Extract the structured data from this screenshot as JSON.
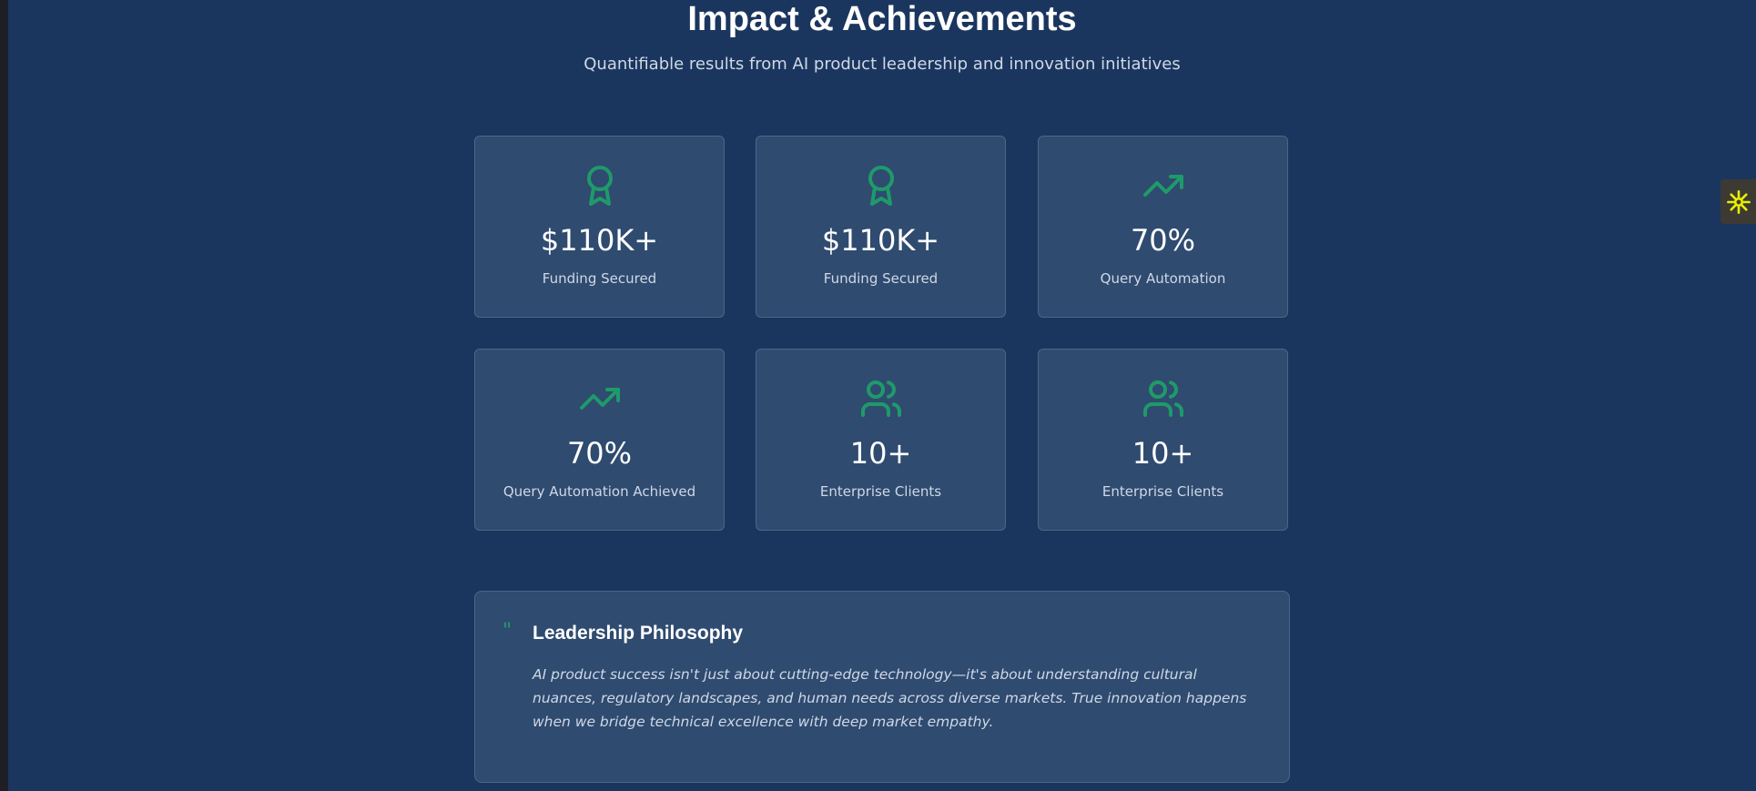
{
  "header": {
    "title": "Impact & Achievements",
    "subtitle": "Quantifiable results from AI product leadership and innovation initiatives"
  },
  "stats": [
    {
      "icon": "award-icon",
      "value": "$110K+",
      "label": "Funding Secured"
    },
    {
      "icon": "award-icon",
      "value": "$110K+",
      "label": "Funding Secured"
    },
    {
      "icon": "trending-up-icon",
      "value": "70%",
      "label": "Query Automation"
    },
    {
      "icon": "trending-up-icon",
      "value": "70%",
      "label": "Query Automation Achieved"
    },
    {
      "icon": "users-icon",
      "value": "10+",
      "label": "Enterprise Clients"
    },
    {
      "icon": "users-icon",
      "value": "10+",
      "label": "Enterprise Clients"
    }
  ],
  "philosophy": {
    "quote_mark": "\"",
    "title": "Leadership Philosophy",
    "text": "AI product success isn't just about cutting-edge technology—it's about understanding cultural nuances, regulatory landscapes, and human needs across diverse markets. True innovation happens when we bridge technical excellence with deep market empathy."
  },
  "colors": {
    "background": "#1b365e",
    "card": "#2f4b70",
    "accent": "#1f9a6a",
    "widget_icon": "#e8f000"
  },
  "side_widget": {
    "icon": "sparkle-icon"
  }
}
